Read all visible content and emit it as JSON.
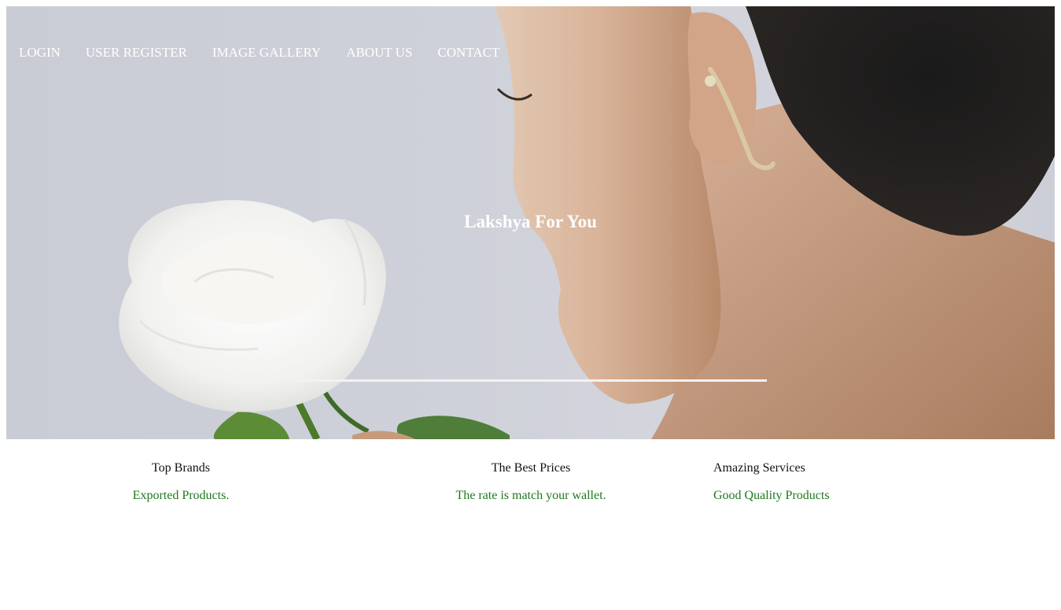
{
  "nav": {
    "items": [
      {
        "label": "LOGIN"
      },
      {
        "label": "USER REGISTER"
      },
      {
        "label": "IMAGE GALLERY"
      },
      {
        "label": "ABOUT US"
      },
      {
        "label": "CONTACT"
      }
    ]
  },
  "hero": {
    "title": "Lakshya For You"
  },
  "features": [
    {
      "title": "Top Brands",
      "subtitle": "Exported Products."
    },
    {
      "title": "The Best Prices",
      "subtitle": "The rate is match your wallet."
    },
    {
      "title": "Amazing Services",
      "subtitle": "Good Quality Products"
    }
  ],
  "colors": {
    "accent_green": "#1d7a1d",
    "nav_text": "#ffffff"
  }
}
